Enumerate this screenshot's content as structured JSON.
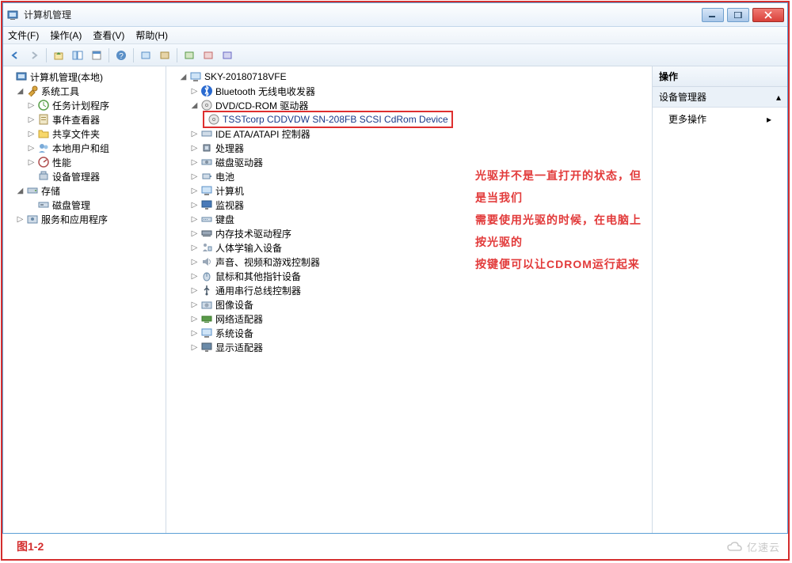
{
  "window": {
    "title": "计算机管理"
  },
  "menu": {
    "file": "文件(F)",
    "action": "操作(A)",
    "view": "查看(V)",
    "help": "帮助(H)"
  },
  "left_tree": {
    "root": "计算机管理(本地)",
    "sys_tools": "系统工具",
    "task_sched": "任务计划程序",
    "event_viewer": "事件查看器",
    "shared_folders": "共享文件夹",
    "local_users": "本地用户和组",
    "performance": "性能",
    "device_mgr": "设备管理器",
    "storage": "存储",
    "disk_mgmt": "磁盘管理",
    "services_apps": "服务和应用程序"
  },
  "center_tree": {
    "root": "SKY-20180718VFE",
    "bluetooth": "Bluetooth 无线电收发器",
    "dvd": "DVD/CD-ROM 驱动器",
    "dvd_child": "TSSTcorp CDDVDW SN-208FB SCSI CdRom Device",
    "ide": "IDE ATA/ATAPI 控制器",
    "cpu": "处理器",
    "disk_drive": "磁盘驱动器",
    "battery": "电池",
    "computer": "计算机",
    "monitor": "监视器",
    "keyboard": "键盘",
    "mem_tech": "内存技术驱动程序",
    "hid": "人体学输入设备",
    "sound": "声音、视频和游戏控制器",
    "mouse": "鼠标和其他指针设备",
    "usb": "通用串行总线控制器",
    "imaging": "图像设备",
    "network": "网络适配器",
    "system": "系统设备",
    "display": "显示适配器"
  },
  "annotation": {
    "line1": "光驱并不是一直打开的状态，但是当我们",
    "line2": "需要使用光驱的时候，在电脑上按光驱的",
    "line3": "按键便可以让CDROM运行起来"
  },
  "right_panel": {
    "header": "操作",
    "sub": "设备管理器",
    "more": "更多操作"
  },
  "figure_label": "图1-2",
  "watermark": "亿速云"
}
